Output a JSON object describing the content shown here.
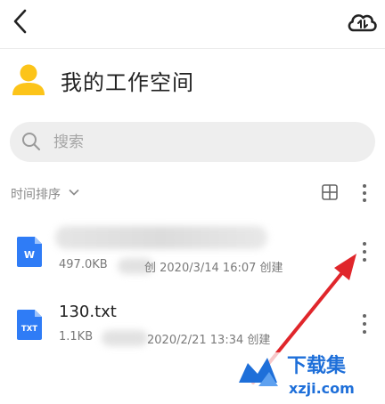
{
  "title": "我的工作空间",
  "search": {
    "placeholder": "搜索"
  },
  "sort": {
    "label": "时间排序"
  },
  "files": [
    {
      "type_label": "W",
      "size": "497.0KB",
      "date_suffix": "创 2020/3/14 16:07 创建",
      "name": ""
    },
    {
      "type_label": "TXT",
      "name": "130.txt",
      "size": "1.1KB",
      "date_suffix": "2020/2/21 13:34 创建"
    }
  ],
  "watermark": {
    "title": "下载集",
    "domain": "xzji.com"
  },
  "colors": {
    "avatar": "#fcc419",
    "file_blue": "#2f7cf6",
    "arrow": "#e0262b",
    "watermark_blue": "#1e6fd9"
  }
}
